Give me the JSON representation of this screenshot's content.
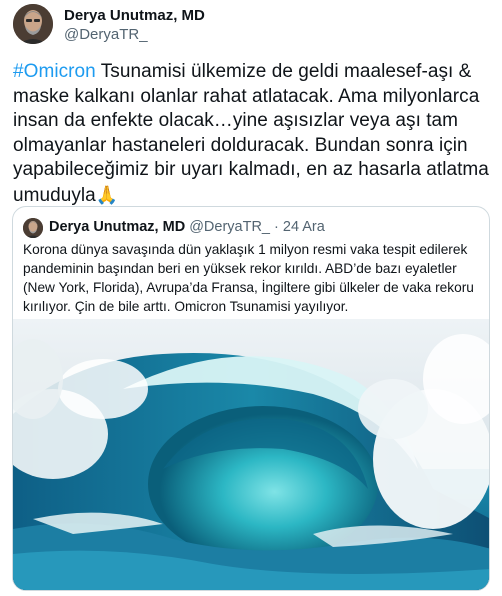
{
  "author": {
    "name": "Derya Unutmaz, MD",
    "handle": "@DeryaTR_"
  },
  "tweet": {
    "hashtag": "#Omicron",
    "text": " Tsunamisi ülkemize de geldi maalesef-aşı & maske kalkanı olanlar rahat atlatacak. Ama milyonlarca insan da enfekte olacak…yine aşısızlar veya aşı tam olmayanlar hastaneleri dolduracak. Bundan sonra için yapabileceğimiz bir uyarı kalmadı, en az hasarla atlatma umuduyla",
    "emoji": "🙏"
  },
  "quoted": {
    "name": "Derya Unutmaz, MD",
    "handle": "@DeryaTR_",
    "separator": "·",
    "date": "24 Ara",
    "text": "Korona dünya savaşında dün yaklaşık 1 milyon resmi vaka tespit edilerek pandeminin başından beri en yüksek rekor kırıldı. ABD’de bazı eyaletler (New York, Florida), Avrupa’da Fransa, İngiltere gibi ülkeler de vaka rekoru kırılıyor. Çin de bile arttı. Omicron Tsunamisi yayılıyor."
  },
  "colors": {
    "hashtag": "#1d9bf0",
    "text": "#0f1419",
    "secondary": "#536471",
    "border": "#cfd9de"
  }
}
